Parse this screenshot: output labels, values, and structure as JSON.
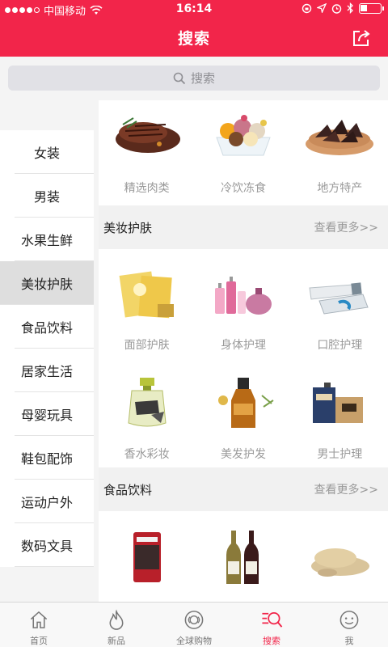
{
  "status_bar": {
    "carrier": "中国移动",
    "time": "16:14"
  },
  "header": {
    "title": "搜索"
  },
  "search": {
    "placeholder": "搜索"
  },
  "sidebar": {
    "items": [
      {
        "label": "女装"
      },
      {
        "label": "男装"
      },
      {
        "label": "水果生鲜"
      },
      {
        "label": "美妆护肤",
        "active": true
      },
      {
        "label": "食品饮料"
      },
      {
        "label": "居家生活"
      },
      {
        "label": "母婴玩具"
      },
      {
        "label": "鞋包配饰"
      },
      {
        "label": "运动户外"
      },
      {
        "label": "数码文具"
      }
    ]
  },
  "content": {
    "top_row": [
      {
        "label": "精选肉类",
        "icon": "steak-icon"
      },
      {
        "label": "冷饮冻食",
        "icon": "ice-cream-icon"
      },
      {
        "label": "地方特产",
        "icon": "dried-fruit-icon"
      }
    ],
    "sections": [
      {
        "title": "美妆护肤",
        "more": "查看更多>>",
        "items": [
          {
            "label": "面部护肤",
            "icon": "face-mask-icon"
          },
          {
            "label": "身体护理",
            "icon": "body-care-icon"
          },
          {
            "label": "口腔护理",
            "icon": "toothpaste-icon"
          },
          {
            "label": "香水彩妆",
            "icon": "perfume-icon"
          },
          {
            "label": "美发护发",
            "icon": "hair-oil-icon"
          },
          {
            "label": "男士护理",
            "icon": "men-care-icon"
          }
        ]
      },
      {
        "title": "食品饮料",
        "more": "查看更多>>",
        "items": [
          {
            "label": "",
            "icon": "coffee-pack-icon"
          },
          {
            "label": "",
            "icon": "wine-bottles-icon"
          },
          {
            "label": "",
            "icon": "grain-icon"
          }
        ]
      }
    ]
  },
  "tabbar": {
    "items": [
      {
        "label": "首页",
        "icon": "home-icon"
      },
      {
        "label": "新品",
        "icon": "flame-icon"
      },
      {
        "label": "全球购物",
        "icon": "globe-shopping-icon"
      },
      {
        "label": "搜索",
        "icon": "search-icon",
        "active": true
      },
      {
        "label": "我",
        "icon": "smiley-icon"
      }
    ]
  },
  "colors": {
    "accent": "#f2254a",
    "muted_text": "#9a9a9a"
  }
}
